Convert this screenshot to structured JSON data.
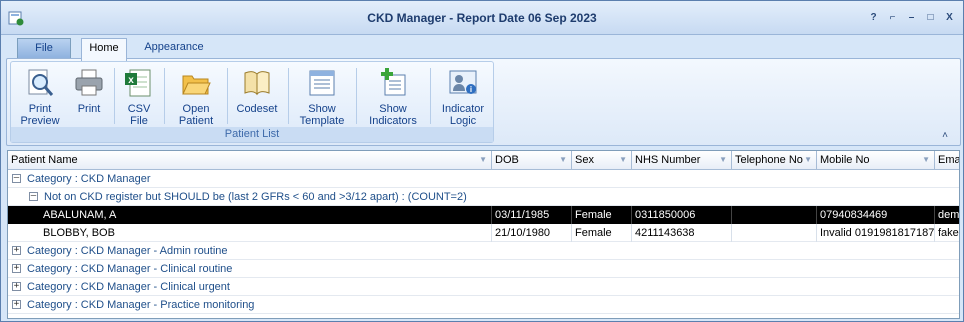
{
  "window": {
    "title": "CKD Manager - Report Date 06 Sep 2023",
    "controls": [
      "?",
      "⌐",
      "–",
      "□",
      "X"
    ]
  },
  "tabs": {
    "file": "File",
    "home": "Home",
    "appearance": "Appearance"
  },
  "ribbon": {
    "group_label": "Patient List",
    "buttons": [
      {
        "label": "Print\nPreview",
        "icon": "print-preview-icon"
      },
      {
        "label": "Print",
        "icon": "printer-icon"
      },
      {
        "label": "CSV\nFile",
        "icon": "csv-file-icon"
      },
      {
        "label": "Open\nPatient",
        "icon": "open-folder-icon"
      },
      {
        "label": "Codeset",
        "icon": "book-icon"
      },
      {
        "label": "Show\nTemplate",
        "icon": "template-icon"
      },
      {
        "label": "Show\nIndicators",
        "icon": "indicators-icon"
      },
      {
        "label": "Indicator\nLogic",
        "icon": "indicator-logic-icon"
      }
    ],
    "collapse": "˄"
  },
  "grid": {
    "columns": [
      "Patient Name",
      "DOB",
      "Sex",
      "NHS Number",
      "Telephone No",
      "Mobile No",
      "Ema"
    ],
    "category_main": "Category : CKD Manager",
    "subgroup": "Not on CKD register but SHOULD be (last 2 GFRs < 60 and >3/12 apart) : (COUNT=2)",
    "rows": [
      {
        "name": "ABALUNAM, A",
        "dob": "03/11/1985",
        "sex": "Female",
        "nhs": "0311850006",
        "tel": "",
        "mobile": "07940834469",
        "email": "dem"
      },
      {
        "name": "BLOBBY, BOB",
        "dob": "21/10/1980",
        "sex": "Female",
        "nhs": "4211143638",
        "tel": "",
        "mobile": "Invalid 0191981817187",
        "email": "fake"
      }
    ],
    "categories": [
      "Category : CKD Manager - Admin routine",
      "Category : CKD Manager - Clinical routine",
      "Category : CKD Manager - Clinical urgent",
      "Category : CKD Manager - Practice monitoring"
    ]
  }
}
